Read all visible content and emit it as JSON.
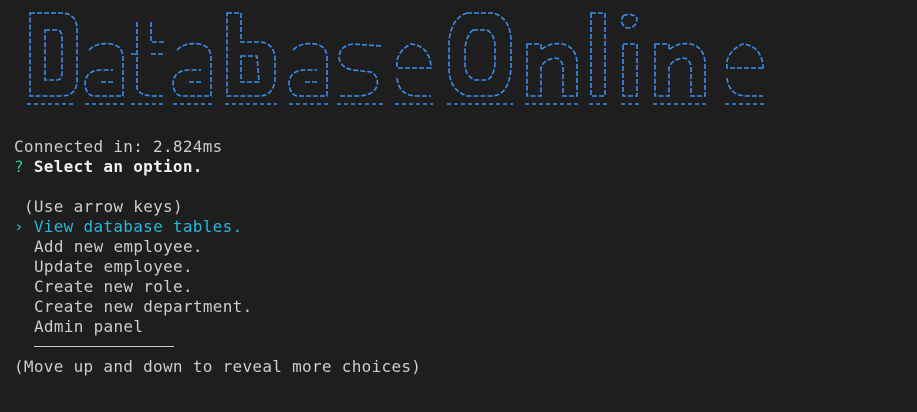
{
  "banner": {
    "text": "DatabaseOnline",
    "color": "#3b8eea"
  },
  "status": {
    "connected": "Connected in: 2.824ms"
  },
  "prompt": {
    "marker": "?",
    "question": "Select an option.",
    "hint": "(Use arrow keys)",
    "pointer": "›"
  },
  "menu": {
    "items": [
      {
        "label": "View database tables."
      },
      {
        "label": "Add new employee."
      },
      {
        "label": "Update employee."
      },
      {
        "label": "Create new role."
      },
      {
        "label": "Create new department."
      },
      {
        "label": "Admin panel"
      }
    ],
    "footer": "(Move up and down to reveal more choices)"
  },
  "colors": {
    "background": "#1e1e1e",
    "text": "#cccccc",
    "selected": "#29b8db",
    "question_mark": "#23d18b",
    "banner": "#3b8eea"
  }
}
